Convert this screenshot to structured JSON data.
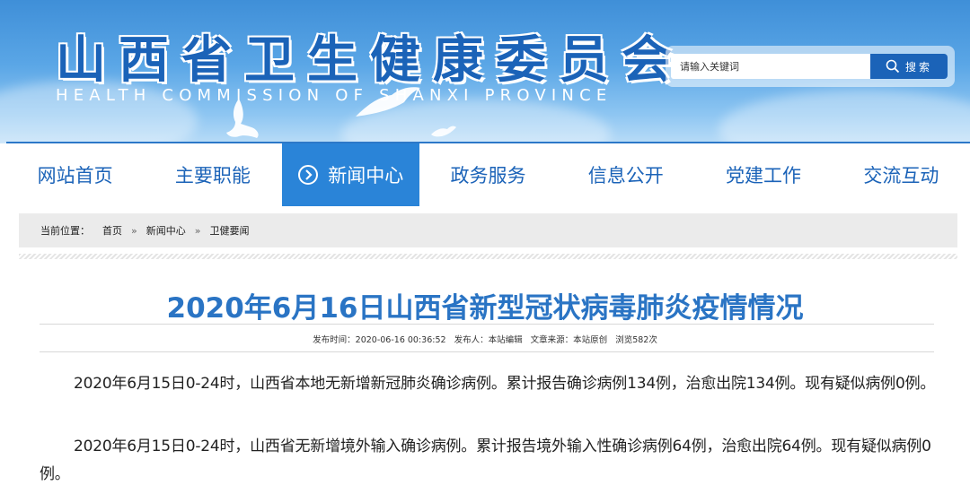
{
  "header": {
    "title": "山西省卫生健康委员会",
    "subtitle": "HEALTH COMMISSION OF SHANXI PROVINCE",
    "search": {
      "placeholder": "请输入关键词",
      "button_label": "搜索",
      "icon": "search-icon"
    }
  },
  "nav": {
    "items": [
      {
        "label": "网站首页",
        "active": false
      },
      {
        "label": "主要职能",
        "active": false
      },
      {
        "label": "新闻中心",
        "active": true,
        "icon": "circle-arrow-icon"
      },
      {
        "label": "政务服务",
        "active": false
      },
      {
        "label": "信息公开",
        "active": false
      },
      {
        "label": "党建工作",
        "active": false
      },
      {
        "label": "交流互动",
        "active": false
      }
    ]
  },
  "breadcrumb": {
    "prefix": "当前位置：",
    "items": [
      "首页",
      "新闻中心",
      "卫健要闻"
    ],
    "separator": "»"
  },
  "article": {
    "title": "2020年6月16日山西省新型冠状病毒肺炎疫情情况",
    "meta": {
      "publish_time": "发布时间：2020-06-16 00:36:52",
      "publisher": "发布人：本站编辑",
      "source": "文章来源：本站原创",
      "views": "浏览582次"
    },
    "paragraphs": [
      "2020年6月15日0-24时，山西省本地无新增新冠肺炎确诊病例。累计报告确诊病例134例，治愈出院134例。现有疑似病例0例。",
      "2020年6月15日0-24时，山西省无新增境外输入确诊病例。累计报告境外输入性确诊病例64例，治愈出院64例。现有疑似病例0例。"
    ]
  },
  "colors": {
    "brand": "#1b63b8",
    "nav_active": "#2a84d8",
    "title": "#2a74c4"
  }
}
